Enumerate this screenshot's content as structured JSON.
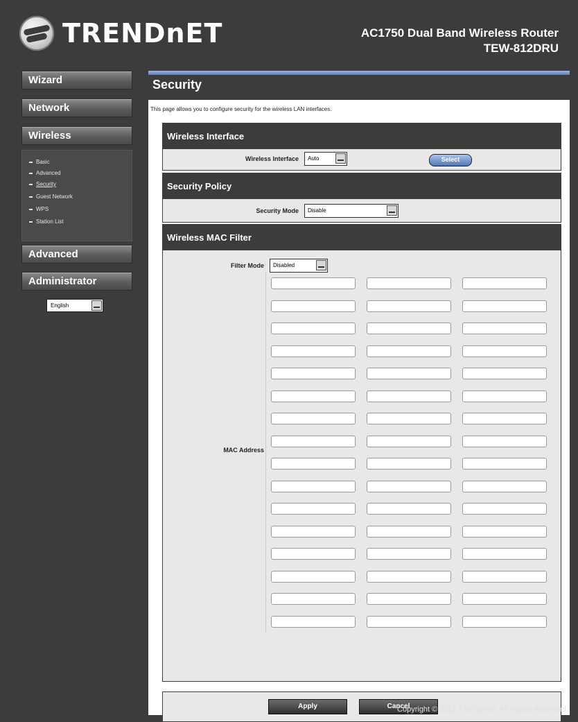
{
  "brand": {
    "logo_text": "TRENDnET",
    "product_name": "AC1750 Dual Band Wireless Router",
    "product_model": "TEW-812DRU"
  },
  "sidebar": {
    "wizard": "Wizard",
    "network": "Network",
    "wireless": "Wireless",
    "wireless_items": [
      {
        "label": "Basic",
        "active": false
      },
      {
        "label": "Advanced",
        "active": false
      },
      {
        "label": "Security",
        "active": true
      },
      {
        "label": "Guest Network",
        "active": false
      },
      {
        "label": "WPS",
        "active": false
      },
      {
        "label": "Station List",
        "active": false
      }
    ],
    "advanced": "Advanced",
    "administrator": "Administrator",
    "language": "English"
  },
  "page": {
    "title": "Security",
    "description": "This page allows you to configure security for the wireless LAN interfaces."
  },
  "wireless_interface": {
    "heading": "Wireless Interface",
    "label": "Wireless Interface",
    "value": "Auto",
    "select_button": "Select"
  },
  "security_policy": {
    "heading": "Security Policy",
    "label": "Security Mode",
    "value": "Disable"
  },
  "mac_filter": {
    "heading": "Wireless MAC Filter",
    "filter_mode_label": "Filter Mode",
    "filter_mode_value": "Disabled",
    "mac_address_label": "MAC Address",
    "rows": 16,
    "columns": 3
  },
  "actions": {
    "apply": "Apply",
    "cancel": "Cancel"
  },
  "footer": {
    "copyright": "Copyright © 2012 TRENDnet. All Rights Reserved."
  }
}
